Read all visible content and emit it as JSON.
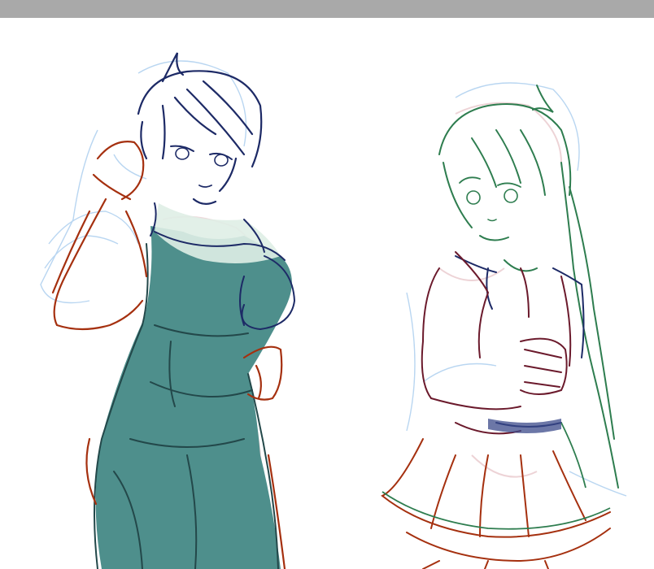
{
  "colors": {
    "top_bar": "#a9a9a9",
    "canvas": "#ffffff",
    "line_navy": "#1d2a66",
    "line_rust": "#a5300f",
    "line_green": "#2e7d4f",
    "line_maroon": "#6b1a2c",
    "line_lightblue": "#a8ccee",
    "line_pink": "#e8c8cc",
    "dress_fill": "#4e8f8c",
    "skin_tint": "#dfeee6"
  },
  "figures": [
    {
      "name": "left-figure",
      "description_icon": "character-sketch-icon"
    },
    {
      "name": "right-figure",
      "description_icon": "character-sketch-icon"
    }
  ]
}
